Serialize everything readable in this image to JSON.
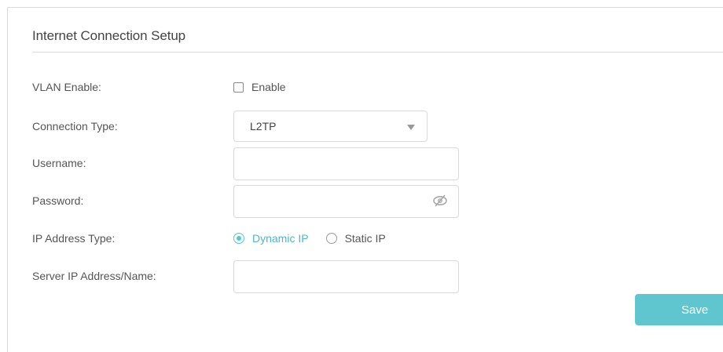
{
  "section": {
    "title": "Internet Connection Setup"
  },
  "vlan": {
    "label": "VLAN Enable:",
    "checkbox_label": "Enable",
    "checked": false
  },
  "connection_type": {
    "label": "Connection Type:",
    "value": "L2TP"
  },
  "username": {
    "label": "Username:",
    "value": ""
  },
  "password": {
    "label": "Password:",
    "value": "",
    "icon": "eye-slash-icon"
  },
  "ip_address_type": {
    "label": "IP Address Type:",
    "options": [
      {
        "label": "Dynamic IP",
        "selected": true
      },
      {
        "label": "Static IP",
        "selected": false
      }
    ]
  },
  "server": {
    "label": "Server IP Address/Name:",
    "value": ""
  },
  "actions": {
    "save_label": "Save"
  },
  "colors": {
    "accent": "#5fc6d0",
    "accent_text": "#4ab9c7",
    "border": "#d9d9d9"
  }
}
